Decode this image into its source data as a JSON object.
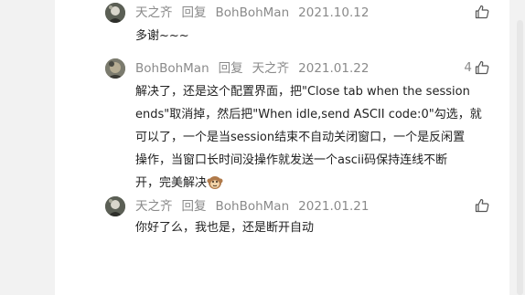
{
  "comments": [
    {
      "author": "天之齐",
      "reply_label": "回复",
      "reply_to": "BohBohMan",
      "date": "2021.10.12",
      "like_count": "",
      "content": "多谢~~~"
    },
    {
      "author": "BohBohMan",
      "reply_label": "回复",
      "reply_to": "天之齐",
      "date": "2021.01.22",
      "like_count": "4",
      "content_lines": [
        "解决了，还是这个配置界面，把\"Close tab when the session",
        "ends\"取消掉，然后把\"When idle,send ASCII code:0\"勾选，就",
        "可以了，一个是当session结束不自动关闭窗口，一个是反闲置",
        "操作，当窗口长时间没操作就发送一个ascii码保持连线不断",
        "开，完美解决"
      ],
      "emoji": "monkey-emoji"
    },
    {
      "author": "天之齐",
      "reply_label": "回复",
      "reply_to": "BohBohMan",
      "date": "2021.01.21",
      "like_count": "",
      "content": "你好了么，我也是，还是断开自动"
    }
  ],
  "icons": {
    "like": "thumbs-up-icon"
  },
  "colors": {
    "meta": "#8a8a8a",
    "text": "#222222",
    "page_bg": "#f2f2f2"
  }
}
